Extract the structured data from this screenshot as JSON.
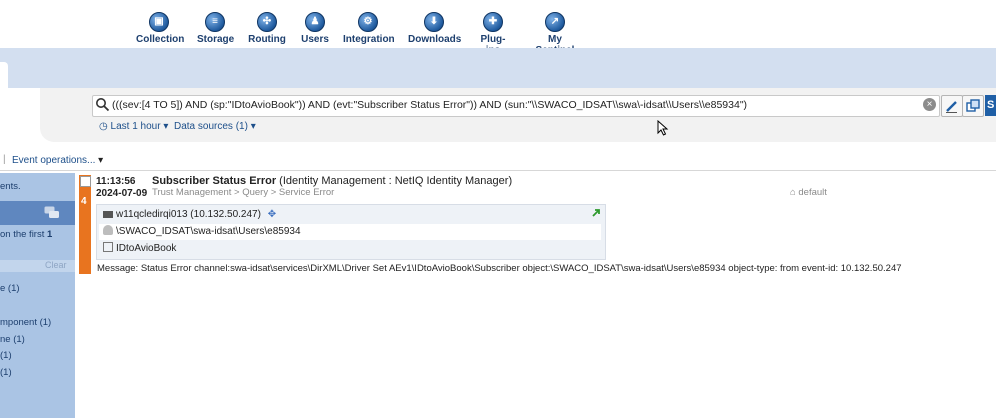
{
  "nav": {
    "items": [
      {
        "label": "Collection",
        "icon": "collection-icon"
      },
      {
        "label": "Storage",
        "icon": "storage-icon"
      },
      {
        "label": "Routing",
        "icon": "routing-icon"
      },
      {
        "label": "Users",
        "icon": "users-icon"
      },
      {
        "label": "Integration",
        "icon": "integration-icon"
      },
      {
        "label": "Downloads",
        "icon": "downloads-icon"
      },
      {
        "label": "Plug-ins",
        "icon": "plugins-icon"
      },
      {
        "label": "My Sentinel",
        "icon": "my-sentinel-icon"
      }
    ]
  },
  "search": {
    "query": "(((sev:[4 TO 5]) AND (sp:\"IDtoAvioBook\")) AND (evt:\"Subscriber Status Error\")) AND (sun:\"\\\\SWACO_IDSAT\\\\swa\\-idsat\\\\Users\\\\e85934\")",
    "time_range": "Last 1 hour",
    "data_sources": "Data sources (1)",
    "submit_label": "S"
  },
  "toolbar": {
    "event_operations": "Event operations..."
  },
  "sidebar": {
    "line1": "ents.",
    "line2_prefix": "on the first ",
    "line2_bold": "1",
    "clear": "Clear",
    "facets": [
      "e (1)",
      "mponent (1)",
      "ne (1)",
      "(1)",
      "(1)"
    ]
  },
  "event": {
    "time": "11:13:56",
    "date": "2024-07-09",
    "severity": "4",
    "title": "Subscriber Status Error",
    "title_detail": "(Identity Management : NetIQ Identity Manager)",
    "taxonomy": "Trust Management > Query > Service Error",
    "tag": "default",
    "host": "w11qcledirqi013 (10.132.50.247)",
    "user": "\\SWACO_IDSAT\\swa-idsat\\Users\\e85934",
    "service": "IDtoAvioBook",
    "message": "Message: Status Error channel:swa-idsat\\services\\DirXML\\Driver Set AEv1\\IDtoAvioBook\\Subscriber object:\\SWACO_IDSAT\\swa-idsat\\Users\\e85934 object-type: from event-id: 10.132.50.247"
  },
  "colors": {
    "severity_accent": "#e8741f",
    "sidebar_bg": "#aac4e4",
    "band_bg": "#d3dff0",
    "link_color": "#1d4f8a"
  }
}
